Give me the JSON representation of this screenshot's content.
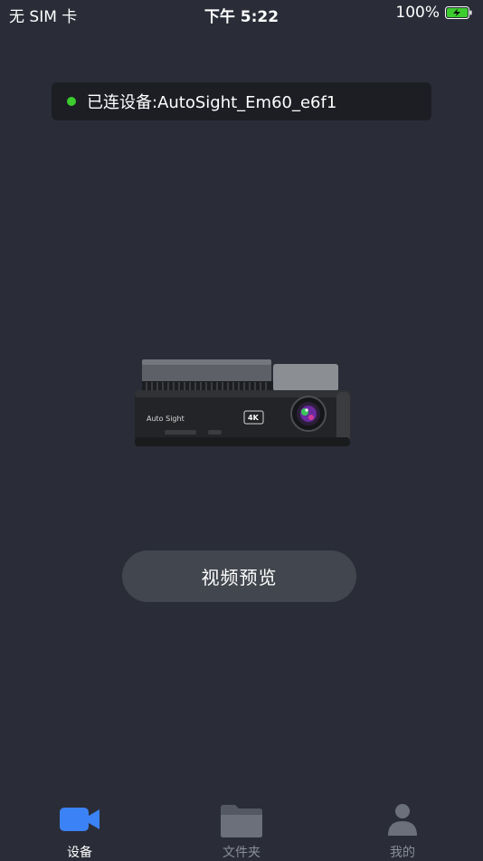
{
  "status_bar": {
    "carrier": "无 SIM 卡",
    "time": "下午 5:22",
    "battery": "100%"
  },
  "connection": {
    "text": "已连设备:AutoSight_Em60_e6f1",
    "status_color": "#3ccc2e"
  },
  "device": {
    "brand_label": "Auto Sight",
    "resolution_badge": "4K"
  },
  "actions": {
    "preview_label": "视频预览"
  },
  "tabs": [
    {
      "label": "设备",
      "icon": "video-camera-icon",
      "active": true
    },
    {
      "label": "文件夹",
      "icon": "folder-icon",
      "active": false
    },
    {
      "label": "我的",
      "icon": "person-icon",
      "active": false
    }
  ],
  "colors": {
    "background": "#2a2d37",
    "accent": "#3b82f6",
    "button": "#42464e"
  }
}
